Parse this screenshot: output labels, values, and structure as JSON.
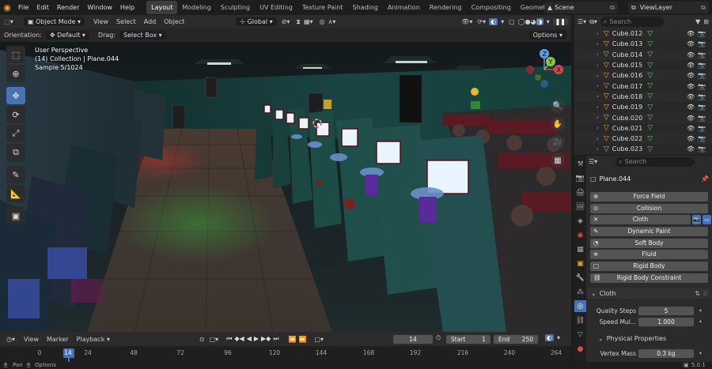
{
  "topbar": {
    "menus": [
      "File",
      "Edit",
      "Render",
      "Window",
      "Help"
    ],
    "workspaces": [
      "Layout",
      "Modeling",
      "Sculpting",
      "UV Editing",
      "Texture Paint",
      "Shading",
      "Animation",
      "Rendering",
      "Compositing",
      "Geometry Node"
    ],
    "active_workspace": "Layout",
    "scene": "Scene",
    "view_layer": "ViewLayer"
  },
  "viewport_header": {
    "mode": "Object Mode",
    "menus": [
      "View",
      "Select",
      "Add",
      "Object"
    ],
    "transform_orientation": "Global"
  },
  "tool_options": {
    "orientation_label": "Orientation:",
    "orientation_value": "Default",
    "drag_label": "Drag:",
    "drag_value": "Select Box",
    "options_label": "Options"
  },
  "overlay": {
    "line1": "User Perspective",
    "line2": "(14) Collection | Plane.044",
    "line3": "Sample 5/1024"
  },
  "gizmo": {
    "x": "X",
    "y": "Y",
    "z": "Z"
  },
  "outliner": {
    "search_placeholder": "Search",
    "items": [
      "Cube.012",
      "Cube.013",
      "Cube.014",
      "Cube.015",
      "Cube.016",
      "Cube.017",
      "Cube.018",
      "Cube.019",
      "Cube.020",
      "Cube.021",
      "Cube.022",
      "Cube.023"
    ]
  },
  "properties": {
    "search_placeholder": "Search",
    "object_name": "Plane.044",
    "physics_buttons": [
      "Force Field",
      "Collision",
      "Cloth",
      "Dynamic Paint",
      "Soft Body",
      "Fluid",
      "Rigid Body",
      "Rigid Body Constraint"
    ],
    "cloth_panel": {
      "title": "Cloth",
      "quality_label": "Quality Steps",
      "quality_value": "5",
      "speed_label": "Speed Mul...",
      "speed_value": "1.000",
      "physical_title": "Physical Properties",
      "vertex_mass_label": "Vertex Mass",
      "vertex_mass_value": "0.3 kg"
    }
  },
  "timeline": {
    "menus": [
      "View",
      "Marker",
      "Playback"
    ],
    "current_frame": "14",
    "start_label": "Start",
    "start_value": "1",
    "end_label": "End",
    "end_value": "250",
    "ticks": [
      "0",
      "14",
      "24",
      "48",
      "72",
      "96",
      "120",
      "144",
      "168",
      "192",
      "216",
      "240",
      "264"
    ]
  },
  "statusbar": {
    "pan": "Pan",
    "options": "Options",
    "version": "5.0.1"
  },
  "colors": {
    "accent": "#4772b3",
    "active_frame": "#4772b3",
    "object_orange": "#e8a33b",
    "mesh_green": "#5bc46a"
  }
}
